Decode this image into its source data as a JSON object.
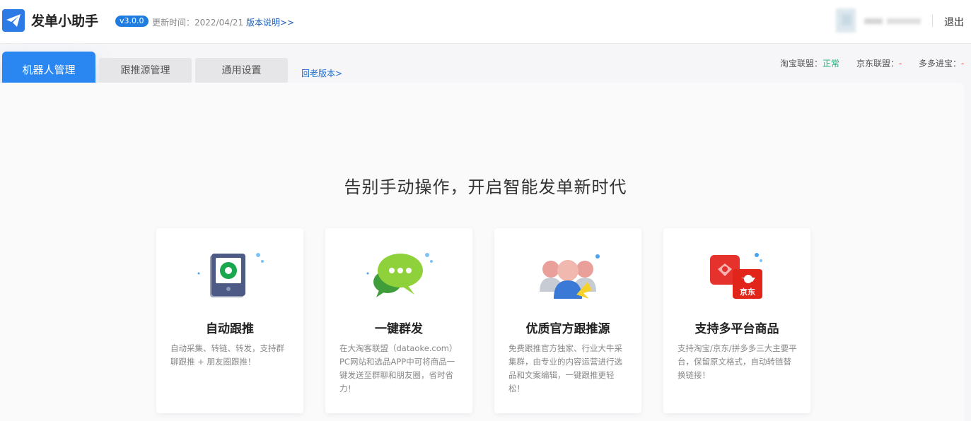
{
  "header": {
    "app_title": "发单小助手",
    "version": "v3.0.0",
    "update_time": "更新时间：2022/04/21",
    "release_notes": "版本说明>>",
    "logout": "退出"
  },
  "tabs": [
    {
      "label": "机器人管理",
      "active": true
    },
    {
      "label": "跟推源管理",
      "active": false
    },
    {
      "label": "通用设置",
      "active": false
    }
  ],
  "old_version_link": "回老版本>",
  "status": [
    {
      "label": "淘宝联盟：",
      "value": "正常",
      "state": "ok"
    },
    {
      "label": "京东联盟：",
      "value": "-",
      "state": "bad"
    },
    {
      "label": "多多进宝：",
      "value": "-",
      "state": "bad"
    }
  ],
  "slogan": "告别手动操作，开启智能发单新时代",
  "features": [
    {
      "icon": "tablet-camera-icon",
      "title": "自动跟推",
      "desc": "自动采集、转链、转发，支持群聊跟推 + 朋友圈跟推！"
    },
    {
      "icon": "chat-bubbles-icon",
      "title": "一键群发",
      "desc": "在大淘客联盟（dataoke.com）PC网站和选品APP中可将商品一键发送至群聊和朋友圈，省时省力！"
    },
    {
      "icon": "users-group-icon",
      "title": "优质官方跟推源",
      "desc": "免费跟推官方独家、行业大牛采集群，由专业的内容运营进行选品和文案编辑，一键跟推更轻松！"
    },
    {
      "icon": "taobao-jd-icon",
      "title": "支持多平台商品",
      "desc": "支持淘宝/京东/拼多多三大主要平台，保留原文格式，自动转链替换链接！"
    }
  ],
  "colors": {
    "brand": "#2a86f0",
    "status_ok": "#19b27a",
    "status_bad": "#e0393e"
  }
}
